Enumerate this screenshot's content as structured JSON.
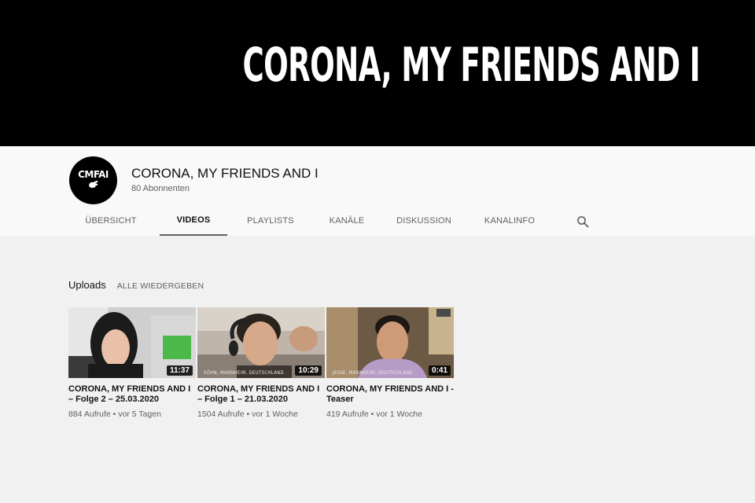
{
  "banner": {
    "title": "CORONA, MY FRIENDS AND I"
  },
  "channel": {
    "avatar_text": "CMFAI",
    "name": "CORONA, MY FRIENDS AND I",
    "subscribers": "80 Abonnenten"
  },
  "tabs": [
    {
      "label": "ÜBERSICHT",
      "active": false
    },
    {
      "label": "VIDEOS",
      "active": true
    },
    {
      "label": "PLAYLISTS",
      "active": false
    },
    {
      "label": "KANÄLE",
      "active": false
    },
    {
      "label": "DISKUSSION",
      "active": false
    },
    {
      "label": "KANALINFO",
      "active": false
    }
  ],
  "search_icon": "search-icon",
  "uploads": {
    "title": "Uploads",
    "play_all": "ALLE WIEDERGEBEN",
    "videos": [
      {
        "title": "CORONA, MY FRIENDS AND I – Folge 2 – 25.03.2020",
        "duration": "11:37",
        "views": "884 Aufrufe",
        "age": "vor 5 Tagen",
        "caption": ""
      },
      {
        "title": "CORONA, MY FRIENDS AND I – Folge 1 – 21.03.2020",
        "duration": "10:29",
        "views": "1504 Aufrufe",
        "age": "vor 1 Woche",
        "caption": "SÖHN, MANNHEIM, DEUTSCHLAND"
      },
      {
        "title": "CORONA, MY FRIENDS AND I - Teaser",
        "duration": "0:41",
        "views": "419 Aufrufe",
        "age": "vor 1 Woche",
        "caption": "JESSE, MANNHEIM, DEUTSCHLAND"
      }
    ]
  },
  "colors": {
    "banner_bg": "#000000",
    "header_bg": "#f9f9f9",
    "page_bg": "#f1f1f1",
    "text_primary": "#111111",
    "text_secondary": "#606060"
  }
}
